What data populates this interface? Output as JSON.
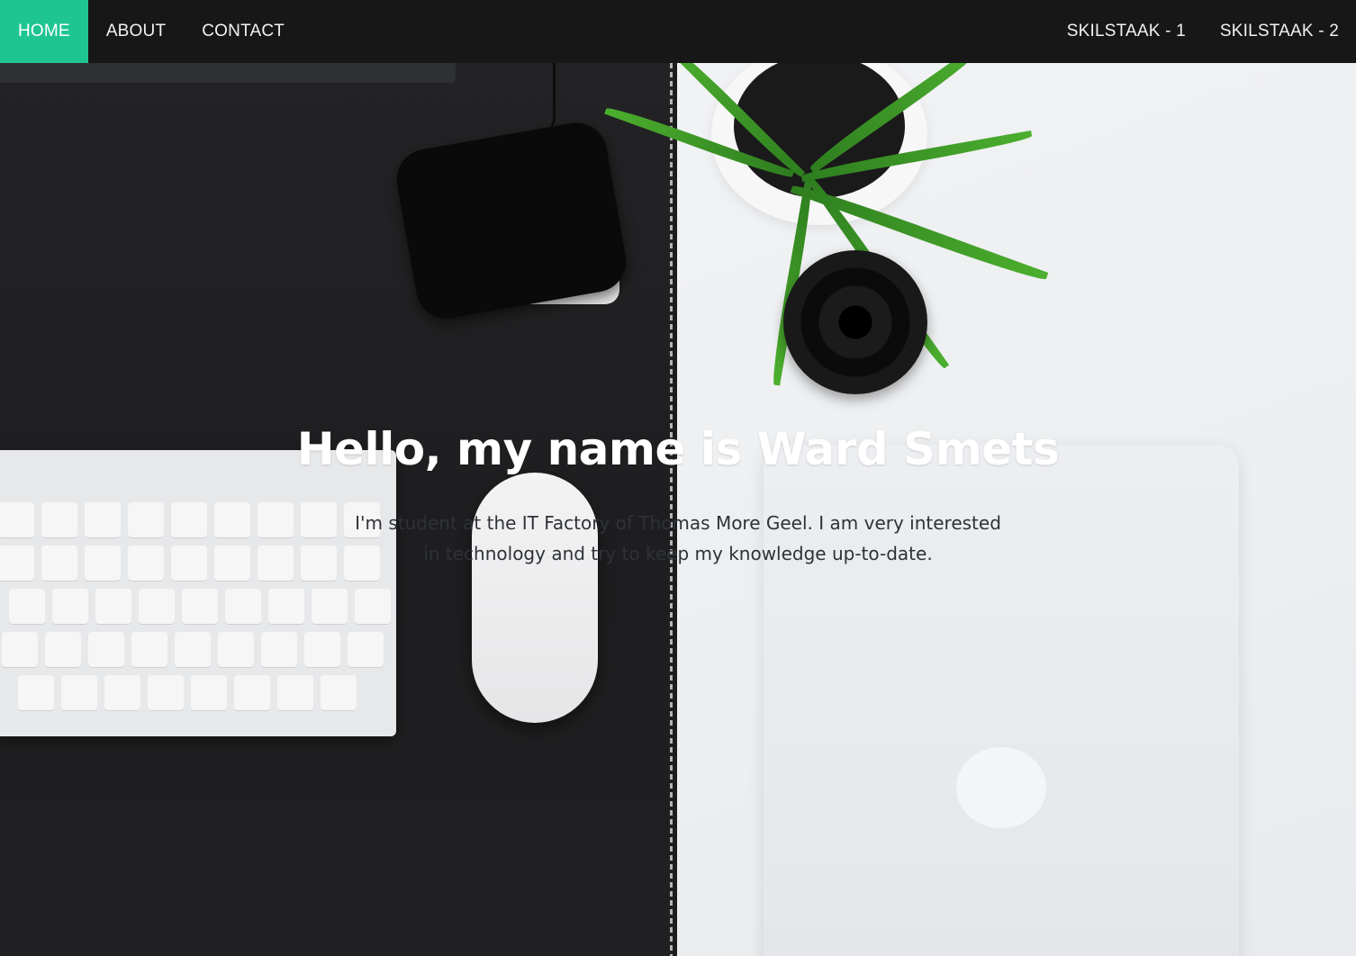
{
  "navbar": {
    "left_items": [
      {
        "label": "HOME",
        "active": true
      },
      {
        "label": "ABOUT",
        "active": false
      },
      {
        "label": "CONTACT",
        "active": false
      }
    ],
    "right_items": [
      {
        "label": "SKILSTAAK - 1"
      },
      {
        "label": "SKILSTAAK - 2"
      }
    ],
    "active_color": "#1fc591",
    "background_color": "#171717"
  },
  "hero": {
    "title": "Hello, my name is Ward Smets",
    "text": "I'm student at the IT Factory of Thomas More Geel. I am very interested in technology and try to keep my knowledge up-to-date."
  }
}
